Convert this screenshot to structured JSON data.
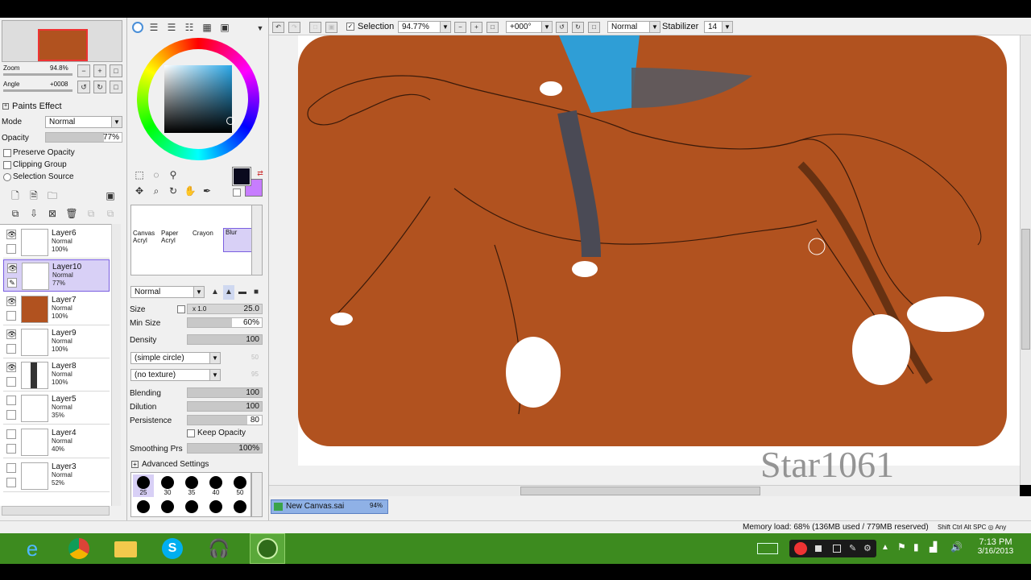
{
  "navigator": {
    "zoom_label": "Zoom",
    "zoom_value": "94.8%",
    "angle_label": "Angle",
    "angle_value": "+0008"
  },
  "paint_effect": {
    "header": "Paints Effect",
    "mode_label": "Mode",
    "mode_value": "Normal",
    "opacity_label": "Opacity",
    "opacity_value": "77%",
    "opacity_fraction": 0.77,
    "preserve_opacity": "Preserve Opacity",
    "clipping_group": "Clipping Group",
    "selection_source": "Selection Source"
  },
  "layers": [
    {
      "name": "Layer6",
      "mode": "Normal",
      "opacity": "100%",
      "selected": false
    },
    {
      "name": "Layer10",
      "mode": "Normal",
      "opacity": "77%",
      "selected": true
    },
    {
      "name": "Layer7",
      "mode": "Normal",
      "opacity": "100%",
      "selected": false
    },
    {
      "name": "Layer9",
      "mode": "Normal",
      "opacity": "100%",
      "selected": false
    },
    {
      "name": "Layer8",
      "mode": "Normal",
      "opacity": "100%",
      "selected": false
    },
    {
      "name": "Layer5",
      "mode": "Normal",
      "opacity": "35%",
      "selected": false
    },
    {
      "name": "Layer4",
      "mode": "Normal",
      "opacity": "40%",
      "selected": false
    },
    {
      "name": "Layer3",
      "mode": "Normal",
      "opacity": "52%",
      "selected": false
    }
  ],
  "tools": {
    "brushes": [
      {
        "line1": "Canvas",
        "line2": "Acryl"
      },
      {
        "line1": "Paper",
        "line2": "Acryl"
      },
      {
        "line1": "Crayon",
        "line2": ""
      },
      {
        "line1": "Blur",
        "line2": ""
      }
    ],
    "blend_mode": "Normal",
    "size_label": "Size",
    "size_mult": "x 1.0",
    "size_value": "25.0",
    "min_size_label": "Min Size",
    "min_size_value": "60%",
    "min_size_fraction": 0.6,
    "density_label": "Density",
    "density_value": "100",
    "shape_value": "(simple circle)",
    "shape_amount": "50",
    "texture_value": "(no texture)",
    "texture_amount": "95",
    "blending_label": "Blending",
    "blending_value": "100",
    "dilution_label": "Dilution",
    "dilution_value": "100",
    "persistence_label": "Persistence",
    "persistence_value": "80",
    "keep_opacity": "Keep Opacity",
    "smoothing_label": "Smoothing Prs",
    "smoothing_value": "100%",
    "advanced": "Advanced Settings",
    "brush_sizes": [
      "25",
      "30",
      "35",
      "40",
      "50"
    ]
  },
  "toolbar": {
    "selection_label": "Selection",
    "zoom_value": "94.77%",
    "angle_value": "+000°",
    "blend_value": "Normal",
    "stabilizer_label": "Stabilizer",
    "stabilizer_value": "14"
  },
  "canvas": {
    "watermark": "Star1061",
    "background": "#b1521f"
  },
  "tab": {
    "name": "New Canvas.sai",
    "zoom": "94%"
  },
  "status": {
    "memory": "Memory load: 68% (136MB used / 779MB reserved)",
    "keys": "Shift Ctrl Alt SPC ◎ Any"
  },
  "taskbar": {
    "time": "7:13 PM",
    "date": "3/16/2013"
  },
  "colors": {
    "primary": "#0a0a1e",
    "secondary": "#c77dff",
    "selection": "#d8d0f6",
    "taskbar": "#3d8b1f"
  }
}
